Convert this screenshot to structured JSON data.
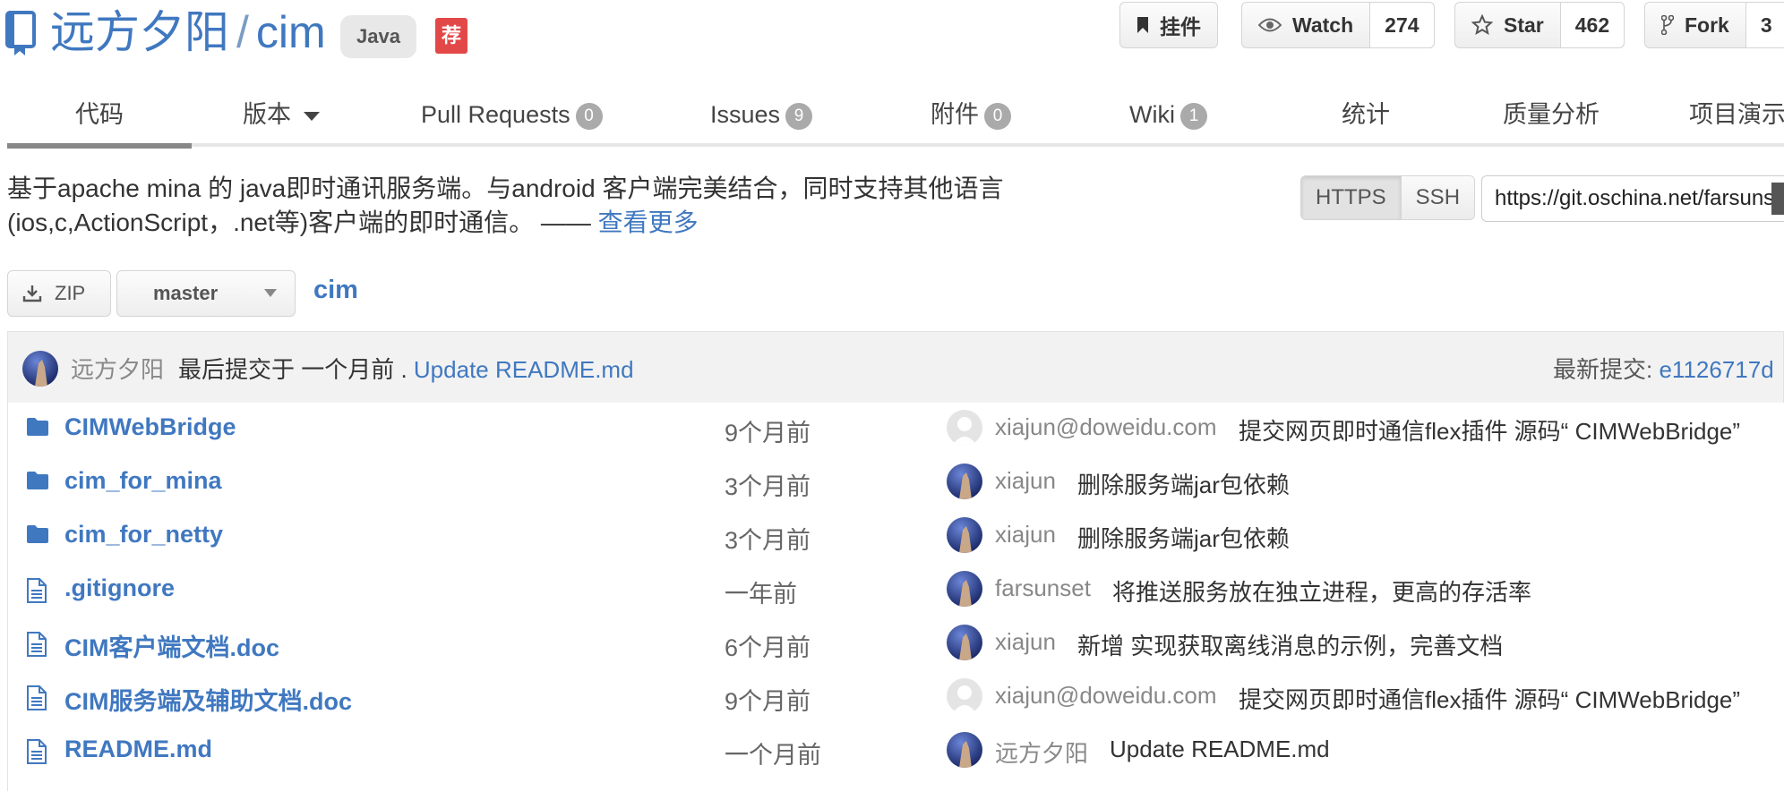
{
  "repo": {
    "owner": "远方夕阳",
    "separator": "/",
    "name": "cim",
    "language": "Java",
    "recommend_tag": "荐"
  },
  "actions": {
    "pin_label": "挂件",
    "watch_label": "Watch",
    "watch_count": "274",
    "star_label": "Star",
    "star_count": "462",
    "fork_label": "Fork",
    "fork_count": "3"
  },
  "tabs": [
    {
      "label": "代码",
      "badge": "",
      "active": true
    },
    {
      "label": "版本",
      "badge": "",
      "dropdown": true
    },
    {
      "label": "Pull Requests",
      "badge": "0"
    },
    {
      "label": "Issues",
      "badge": "9"
    },
    {
      "label": "附件",
      "badge": "0"
    },
    {
      "label": "Wiki",
      "badge": "1"
    },
    {
      "label": "统计",
      "badge": ""
    },
    {
      "label": "质量分析",
      "badge": ""
    },
    {
      "label": "项目演示",
      "badge": ""
    }
  ],
  "description": {
    "text": "基于apache mina 的 java即时通讯服务端。与android 客户端完美结合，同时支持其他语言(ios,c,ActionScript，.net等)客户端的即时通信。 ——",
    "more_link": "查看更多"
  },
  "clone": {
    "https_label": "HTTPS",
    "ssh_label": "SSH",
    "url": "https://git.oschina.net/farsunset/cim.git"
  },
  "toolbar": {
    "zip_label": "ZIP",
    "branch": "master",
    "path": "cim"
  },
  "last_commit": {
    "author": "远方夕阳",
    "text": "最后提交于 一个月前 .",
    "message": "Update README.md",
    "latest_label": "最新提交:",
    "latest_hash": "e1126717d"
  },
  "files": [
    {
      "type": "folder",
      "name": "CIMWebBridge",
      "age": "9个月前",
      "author": "xiajun@doweidu.com",
      "avatar": "default",
      "message": "提交网页即时通信flex插件 源码“ CIMWebBridge”"
    },
    {
      "type": "folder",
      "name": "cim_for_mina",
      "age": "3个月前",
      "author": "xiajun",
      "avatar": "photo",
      "message": "删除服务端jar包依赖"
    },
    {
      "type": "folder",
      "name": "cim_for_netty",
      "age": "3个月前",
      "author": "xiajun",
      "avatar": "photo",
      "message": "删除服务端jar包依赖"
    },
    {
      "type": "file",
      "name": ".gitignore",
      "age": "一年前",
      "author": "farsunset",
      "avatar": "photo",
      "message": "将推送服务放在独立进程，更高的存活率"
    },
    {
      "type": "file",
      "name": "CIM客户端文档.doc",
      "age": "6个月前",
      "author": "xiajun",
      "avatar": "photo",
      "message": "新增 实现获取离线消息的示例，完善文档"
    },
    {
      "type": "file",
      "name": "CIM服务端及辅助文档.doc",
      "age": "9个月前",
      "author": "xiajun@doweidu.com",
      "avatar": "default",
      "message": "提交网页即时通信flex插件 源码“ CIMWebBridge”"
    },
    {
      "type": "file",
      "name": "README.md",
      "age": "一个月前",
      "author": "远方夕阳",
      "avatar": "photo",
      "message": "Update README.md"
    }
  ],
  "colors": {
    "link": "#4078c0",
    "badge": "#aaaaaa",
    "recommend": "#e24848"
  }
}
